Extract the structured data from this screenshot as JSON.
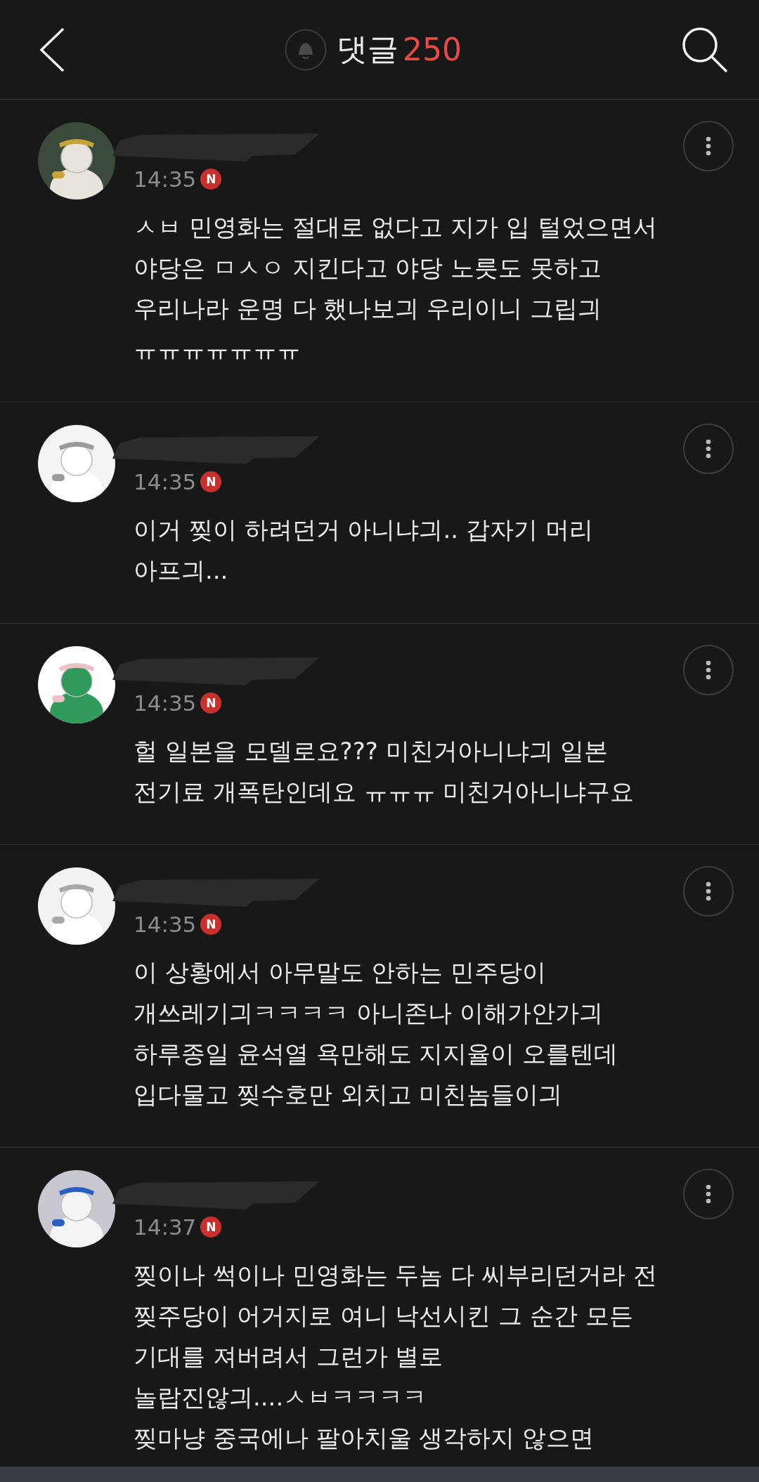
{
  "header": {
    "title": "댓글",
    "count": "250"
  },
  "comments": [
    {
      "time": "14:35",
      "badge": "N",
      "text": "ㅅㅂ 민영화는 절대로 없다고 지가 입 털었으면서\n야당은 ㅁㅅㅇ 지킨다고 야당 노릇도 못하고\n우리나라 운명 다 했나보긔 우리이니 그립긔\nㅠㅠㅠㅠㅠㅠㅠ"
    },
    {
      "time": "14:35",
      "badge": "N",
      "text": "이거 찢이 하려던거 아니냐긔.. 갑자기 머리\n아프긔..."
    },
    {
      "time": "14:35",
      "badge": "N",
      "text": "헐 일본을 모델로요??? 미친거아니냐긔 일본\n전기료 개폭탄인데요 ㅠㅠㅠ 미친거아니냐구요"
    },
    {
      "time": "14:35",
      "badge": "N",
      "text": "이 상황에서 아무말도 안하는 민주당이\n개쓰레기긔ㅋㅋㅋㅋ 아니존나 이해가안가긔\n하루종일 윤석열 욕만해도 지지율이 오를텐데\n입다물고 찢수호만 외치고 미친놈들이긔"
    },
    {
      "time": "14:37",
      "badge": "N",
      "text": "찢이나 썩이나 민영화는 두놈 다 씨부리던거라 전\n찢주당이 어거지로 여니 낙선시킨 그 순간 모든\n기대를 져버려서 그런가 별로\n놀랍진않긔....ㅅㅂㅋㅋㅋㅋ\n찢마냥 중국에나 팔아치울 생각하지 않으면"
    }
  ]
}
